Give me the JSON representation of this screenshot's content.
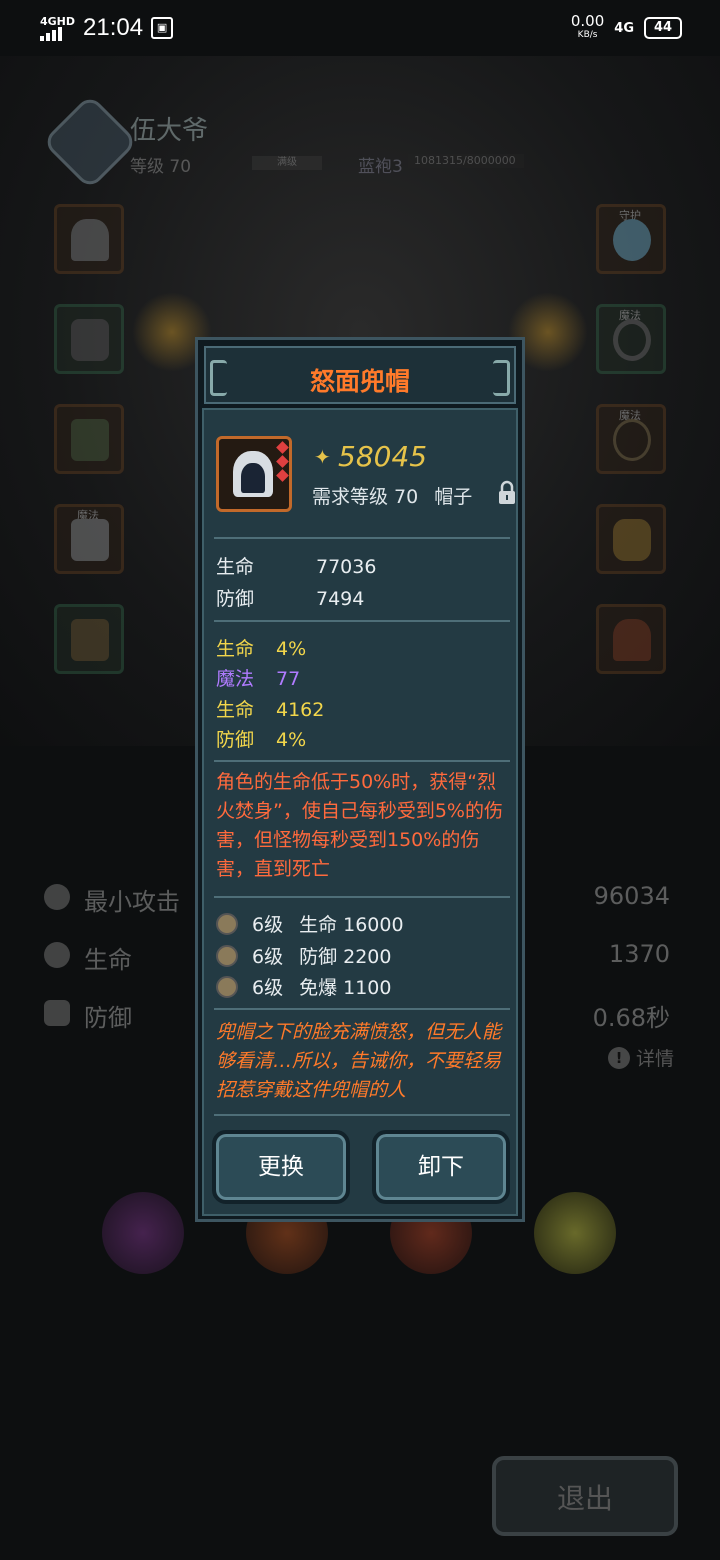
{
  "status_bar": {
    "network": "4GHD",
    "time": "21:04",
    "speed": "0.00",
    "speed_unit": "KB/s",
    "signal": "4G",
    "battery": "44"
  },
  "hero": {
    "name": "伍大爷",
    "level": "等级 70",
    "bar_label": "满级",
    "rank": "蓝袍3",
    "exp": "1081315/8000000"
  },
  "equip_slots": {
    "left_tag_4": "魔法",
    "right_tag_1": "守护",
    "right_tag_2": "魔法",
    "right_tag_3": "魔法"
  },
  "stats": [
    {
      "label": "最小攻击",
      "value": "96034"
    },
    {
      "label": "生命",
      "value": "1370"
    },
    {
      "label": "防御",
      "value": "0.68秒"
    }
  ],
  "detail_label": "详情",
  "exit_label": "退出",
  "item": {
    "title": "怒面兜帽",
    "score": "58045",
    "required_level": "需求等级 70",
    "slot_type": "帽子",
    "base_stats": [
      {
        "label": "生命",
        "value": "77036"
      },
      {
        "label": "防御",
        "value": "7494"
      }
    ],
    "bonus_stats": [
      {
        "label": "生命",
        "value": "4%",
        "color": "#f2d64b"
      },
      {
        "label": "魔法",
        "value": "77",
        "color": "#b07bff"
      },
      {
        "label": "生命",
        "value": "4162",
        "color": "#f2d64b"
      },
      {
        "label": "防御",
        "value": "4%",
        "color": "#f2d64b"
      }
    ],
    "skill_text": "角色的生命低于50%时，获得“烈火焚身”，使自己每秒受到5%的伤害，但怪物每秒受到150%的伤害，直到死亡",
    "set_bonuses": [
      {
        "level": "6级",
        "text": "生命 16000"
      },
      {
        "level": "6级",
        "text": "防御 2200"
      },
      {
        "level": "6级",
        "text": "免爆 1100"
      }
    ],
    "lore": "兜帽之下的脸充满愤怒，但无人能够看清…所以，告诫你，不要轻易招惹穿戴这件兜帽的人",
    "replace_button": "更换",
    "unequip_button": "卸下"
  }
}
